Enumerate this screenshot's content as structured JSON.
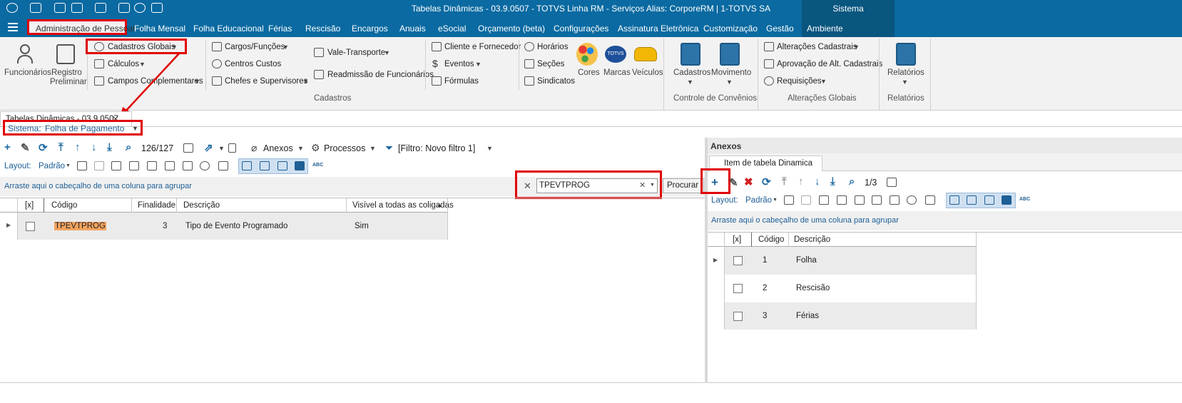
{
  "window": {
    "title": "Tabelas Dinâmicas - 03.9.0507 - TOTVS Linha RM - Serviços  Alias: CorporeRM | 1-TOTVS SA",
    "sistema_label": "Sistema"
  },
  "menu": [
    "Administração de Pessoal",
    "Folha Mensal",
    "Folha Educacional",
    "Férias",
    "Rescisão",
    "Encargos",
    "Anuais",
    "eSocial",
    "Orçamento (beta)",
    "Configurações",
    "Assinatura Eletrônica",
    "Customização",
    "Gestão",
    "Ambiente"
  ],
  "ribbon": {
    "funcionarios": "Funcionários",
    "registro1": "Registro",
    "registro2": "Preliminar",
    "cadastros_globais": "Cadastros Globais",
    "calculos": "Cálculos",
    "campos": "Campos Complementares",
    "cargos": "Cargos/Funções",
    "centros": "Centros Custos",
    "chefes": "Chefes e Supervisores",
    "vale": "Vale-Transporte",
    "readmissao": "Readmissão de Funcionários",
    "cliente": "Cliente e Fornecedor",
    "eventos": "Eventos",
    "formulas": "Fórmulas",
    "horarios": "Horários",
    "secoes": "Seções",
    "sindicatos": "Sindicatos",
    "cores": "Cores",
    "marcas": "Marcas",
    "veiculos": "Veículos",
    "totvs": "TOTVS",
    "cadastros_group": "Cadastros",
    "cadastros_btn": "Cadastros",
    "movimento_btn": "Movimento",
    "convenios_group": "Controle de Convênios",
    "alteracoes": "Alterações Cadastrais",
    "aprovacao": "Aprovação de Alt. Cadastrais",
    "requisicoes": "Requisições",
    "alteracoes_group": "Alterações Globais",
    "relatorios_btn": "Relatórios",
    "relatorios_group": "Relatórios"
  },
  "doc_tab": "Tabelas Dinâmicas - 03.9.0507",
  "sistema": {
    "label": "Sistema:",
    "value": "Folha de Pagamento"
  },
  "toolbar": {
    "count": "126/127",
    "anexos": "Anexos",
    "processos": "Processos",
    "filtro": "[Filtro: Novo filtro 1]",
    "layout": "Layout:",
    "padrao": "Padrão"
  },
  "group_hint": "Arraste aqui o cabeçalho de uma coluna para agrupar",
  "search": {
    "value": "TPEVTPROG",
    "button": "Procurar"
  },
  "main_grid": {
    "headers": [
      "[x]",
      "Código",
      "Finalidade",
      "Descrição",
      "Visível a todas as coligadas"
    ],
    "rows": [
      {
        "codigo": "TPEVTPROG",
        "finalidade": "3",
        "descricao": "Tipo de Evento Programado",
        "visivel": "Sim"
      }
    ]
  },
  "anexos_panel": {
    "title": "Anexos",
    "tab": "Item de tabela Dinamica",
    "count": "1/3",
    "layout": "Layout:",
    "padrao": "Padrão",
    "group_hint": "Arraste aqui o cabeçalho de uma coluna para agrupar",
    "headers": [
      "[x]",
      "Código",
      "Descrição"
    ],
    "rows": [
      {
        "codigo": "1",
        "descricao": "Folha"
      },
      {
        "codigo": "2",
        "descricao": "Rescisão"
      },
      {
        "codigo": "3",
        "descricao": "Férias"
      }
    ]
  },
  "colors": {
    "titlebar": "#0a6aa1",
    "highlight": "#e00000",
    "accent": "#1e5f96"
  }
}
